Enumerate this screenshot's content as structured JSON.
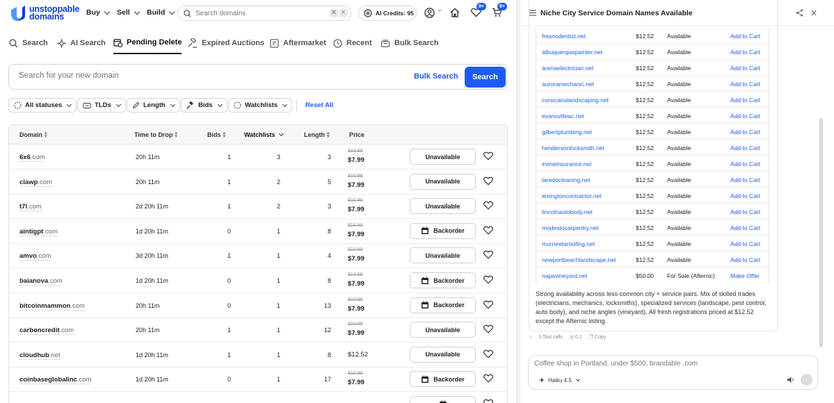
{
  "brand": {
    "line1": "unstoppable",
    "line2": "domains",
    "color": "#0b3cdb"
  },
  "topnav": {
    "menus": [
      "Buy",
      "Sell",
      "Build"
    ],
    "search_placeholder": "Search domains",
    "kbd1": "⌘",
    "kbd2": "K",
    "credits": "AI Credits: 95",
    "badge_favorites": "9+",
    "badge_cart": "9+"
  },
  "tabs": [
    "Search",
    "AI Search",
    "Pending Delete",
    "Expired Auctions",
    "Aftermarket",
    "Recent",
    "Bulk Search"
  ],
  "active_tab": "Pending Delete",
  "main_search": {
    "placeholder": "Search for your new domain",
    "bulk_label": "Bulk Search",
    "search_label": "Search"
  },
  "filters": [
    "All statuses",
    "TLDs",
    "Length",
    "Bids",
    "Watchlists"
  ],
  "reset_label": "Reset All",
  "table": {
    "headers": [
      "Domain",
      "Time to Drop",
      "Bids",
      "Watchlists",
      "Length",
      "Price"
    ],
    "rows": [
      {
        "name": "6x6",
        "tld": ".com",
        "drop": "20h 11m",
        "bids": "1",
        "watch": "3",
        "len": "3",
        "old": "$10.99",
        "price": "$7.99",
        "action": "Unavailable"
      },
      {
        "name": "clawp",
        "tld": ".com",
        "drop": "20h 11m",
        "bids": "1",
        "watch": "2",
        "len": "5",
        "old": "$10.99",
        "price": "$7.99",
        "action": "Unavailable"
      },
      {
        "name": "t7l",
        "tld": ".com",
        "drop": "2d 20h 11m",
        "bids": "1",
        "watch": "2",
        "len": "3",
        "old": "$10.99",
        "price": "$7.99",
        "action": "Unavailable"
      },
      {
        "name": "aintigpt",
        "tld": ".com",
        "drop": "1d 20h 11m",
        "bids": "0",
        "watch": "1",
        "len": "8",
        "old": "$10.99",
        "price": "$7.99",
        "action": "Backorder"
      },
      {
        "name": "amvo",
        "tld": ".com",
        "drop": "3d 20h 11m",
        "bids": "1",
        "watch": "1",
        "len": "4",
        "old": "$10.99",
        "price": "$7.99",
        "action": "Unavailable"
      },
      {
        "name": "baianova",
        "tld": ".com",
        "drop": "1d 20h 11m",
        "bids": "0",
        "watch": "1",
        "len": "8",
        "old": "$10.99",
        "price": "$7.99",
        "action": "Backorder"
      },
      {
        "name": "bitcoinmammon",
        "tld": ".com",
        "drop": "20h 11m",
        "bids": "0",
        "watch": "1",
        "len": "13",
        "old": "$10.99",
        "price": "$7.99",
        "action": "Backorder"
      },
      {
        "name": "carboncredit",
        "tld": ".com",
        "drop": "20h 11m",
        "bids": "1",
        "watch": "1",
        "len": "12",
        "old": "$10.99",
        "price": "$7.99",
        "action": "Unavailable"
      },
      {
        "name": "cloudhub",
        "tld": ".net",
        "drop": "1d 20h 11m",
        "bids": "1",
        "watch": "1",
        "len": "8",
        "old": "",
        "price": "$12.52",
        "action": "Unavailable"
      },
      {
        "name": "coinbaseglobalinc",
        "tld": ".com",
        "drop": "1d 20h 11m",
        "bids": "0",
        "watch": "1",
        "len": "17",
        "old": "$10.99",
        "price": "$7.99",
        "action": "Backorder"
      }
    ]
  },
  "panel": {
    "title": "Niche City Service Domain Names Available",
    "rows": [
      {
        "domain": "fresnodentist.net",
        "price": "$12.52",
        "status": "Available",
        "action": "Add to Cart"
      },
      {
        "domain": "albuquerquepainter.net",
        "price": "$12.52",
        "status": "Available",
        "action": "Add to Cart"
      },
      {
        "domain": "arenaelectrician.net",
        "price": "$12.52",
        "status": "Available",
        "action": "Add to Cart"
      },
      {
        "domain": "auroramechanic.net",
        "price": "$12.52",
        "status": "Available",
        "action": "Add to Cart"
      },
      {
        "domain": "corsicanalandscaping.net",
        "price": "$12.52",
        "status": "Available",
        "action": "Add to Cart"
      },
      {
        "domain": "evansvilleac.net",
        "price": "$12.52",
        "status": "Available",
        "action": "Add to Cart"
      },
      {
        "domain": "gilbertplumbing.net",
        "price": "$12.52",
        "status": "Available",
        "action": "Add to Cart"
      },
      {
        "domain": "hendersonlocksmith.net",
        "price": "$12.52",
        "status": "Available",
        "action": "Add to Cart"
      },
      {
        "domain": "irvineinsurance.net",
        "price": "$12.52",
        "status": "Available",
        "action": "Add to Cart"
      },
      {
        "domain": "laredocleaning.net",
        "price": "$12.52",
        "status": "Available",
        "action": "Add to Cart"
      },
      {
        "domain": "lexingtoncontractor.net",
        "price": "$12.52",
        "status": "Available",
        "action": "Add to Cart"
      },
      {
        "domain": "lincolnautobody.net",
        "price": "$12.52",
        "status": "Available",
        "action": "Add to Cart"
      },
      {
        "domain": "modestocarpentry.net",
        "price": "$12.52",
        "status": "Available",
        "action": "Add to Cart"
      },
      {
        "domain": "murrieetaroofing.net",
        "price": "$12.52",
        "status": "Available",
        "action": "Add to Cart"
      },
      {
        "domain": "newportbeachlandscape.net",
        "price": "$12.52",
        "status": "Available",
        "action": "Add to Cart"
      },
      {
        "domain": "napavineyard.net",
        "price": "$50.00",
        "status": "For Sale (Afternic)",
        "action": "Make Offer"
      }
    ],
    "description": "Strong availability across less common city + service pairs. Mix of skilled trades (electricians, mechanics, locksmiths), specialized services (landscape, pest control, auto body), and niche angles (vineyard). All fresh registrations priced at $12.52 except the Afternic listing.",
    "tool_calls": "3 Tool calls",
    "cost": "0.1",
    "copy_label": "Copy",
    "chat_placeholder": "Coffee shop in Portland, under $500, brandable .com",
    "model": "Haiku 4.5"
  }
}
